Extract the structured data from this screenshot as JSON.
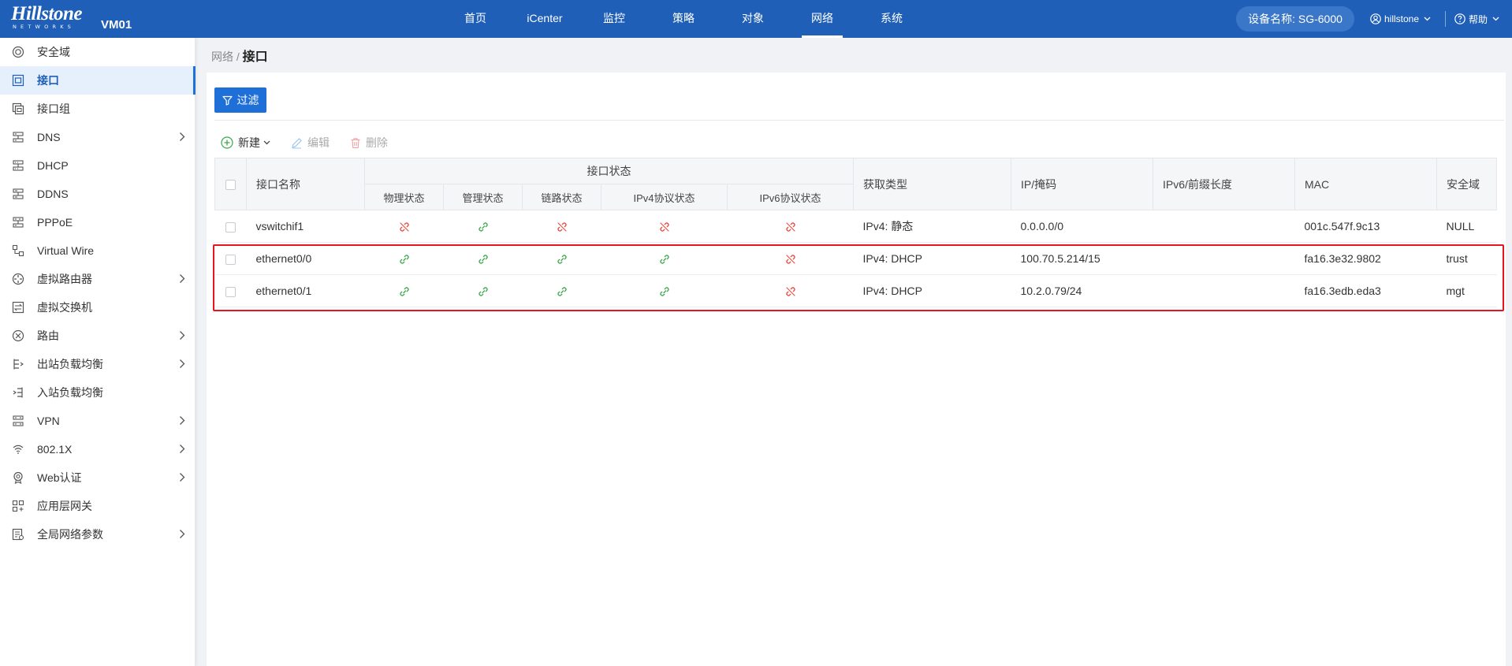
{
  "header": {
    "logo_main": "Hillstone",
    "logo_sub": "NETWORKS",
    "device_short": "VM01",
    "nav": [
      {
        "label": "首页"
      },
      {
        "label": "iCenter"
      },
      {
        "label": "监控"
      },
      {
        "label": "策略"
      },
      {
        "label": "对象"
      },
      {
        "label": "网络",
        "active": true
      },
      {
        "label": "系统"
      }
    ],
    "device_name": "设备名称: SG-6000",
    "user": "hillstone",
    "help": "帮助"
  },
  "sidebar": {
    "items": [
      {
        "label": "安全域",
        "icon": "zone-icon"
      },
      {
        "label": "接口",
        "icon": "interface-icon",
        "active": true
      },
      {
        "label": "接口组",
        "icon": "interface-group-icon"
      },
      {
        "label": "DNS",
        "icon": "dns-icon",
        "expandable": true
      },
      {
        "label": "DHCP",
        "icon": "dhcp-icon"
      },
      {
        "label": "DDNS",
        "icon": "ddns-icon"
      },
      {
        "label": "PPPoE",
        "icon": "pppoe-icon"
      },
      {
        "label": "Virtual Wire",
        "icon": "virtual-wire-icon"
      },
      {
        "label": "虚拟路由器",
        "icon": "virtual-router-icon",
        "expandable": true
      },
      {
        "label": "虚拟交换机",
        "icon": "virtual-switch-icon"
      },
      {
        "label": "路由",
        "icon": "route-icon",
        "expandable": true
      },
      {
        "label": "出站负载均衡",
        "icon": "outbound-lb-icon",
        "expandable": true
      },
      {
        "label": "入站负载均衡",
        "icon": "inbound-lb-icon"
      },
      {
        "label": "VPN",
        "icon": "vpn-icon",
        "expandable": true
      },
      {
        "label": "802.1X",
        "icon": "dot1x-icon",
        "expandable": true
      },
      {
        "label": "Web认证",
        "icon": "web-auth-icon",
        "expandable": true
      },
      {
        "label": "应用层网关",
        "icon": "alg-icon"
      },
      {
        "label": "全局网络参数",
        "icon": "global-params-icon",
        "expandable": true
      }
    ]
  },
  "breadcrumb": {
    "parent": "网络",
    "sep": "/",
    "current": "接口"
  },
  "toolbar": {
    "filter": "过滤",
    "new": "新建",
    "edit": "编辑",
    "delete": "删除"
  },
  "table": {
    "headers": {
      "name": "接口名称",
      "status_group": "接口状态",
      "physical": "物理状态",
      "admin": "管理状态",
      "link": "链路状态",
      "ipv4": "IPv4协议状态",
      "ipv6": "IPv6协议状态",
      "type": "获取类型",
      "ip": "IP/掩码",
      "ipv6prefix": "IPv6/前缀长度",
      "mac": "MAC",
      "zone": "安全域"
    },
    "rows": [
      {
        "name": "vswitchif1",
        "status": [
          "down",
          "up",
          "down",
          "down",
          "down"
        ],
        "type": "IPv4: 静态",
        "ip": "0.0.0.0/0",
        "ipv6": "",
        "mac": "001c.547f.9c13",
        "zone": "NULL"
      },
      {
        "name": "ethernet0/0",
        "status": [
          "up",
          "up",
          "up",
          "up",
          "down"
        ],
        "type": "IPv4: DHCP",
        "ip": "100.70.5.214/15",
        "ipv6": "",
        "mac": "fa16.3e32.9802",
        "zone": "trust"
      },
      {
        "name": "ethernet0/1",
        "status": [
          "up",
          "up",
          "up",
          "up",
          "down"
        ],
        "type": "IPv4: DHCP",
        "ip": "10.2.0.79/24",
        "ipv6": "",
        "mac": "fa16.3edb.eda3",
        "zone": "mgt"
      }
    ]
  },
  "colors": {
    "primary": "#1f5fb7",
    "link_up": "#3aa84a",
    "link_down": "#e8463c",
    "highlight": "#e8141e"
  }
}
